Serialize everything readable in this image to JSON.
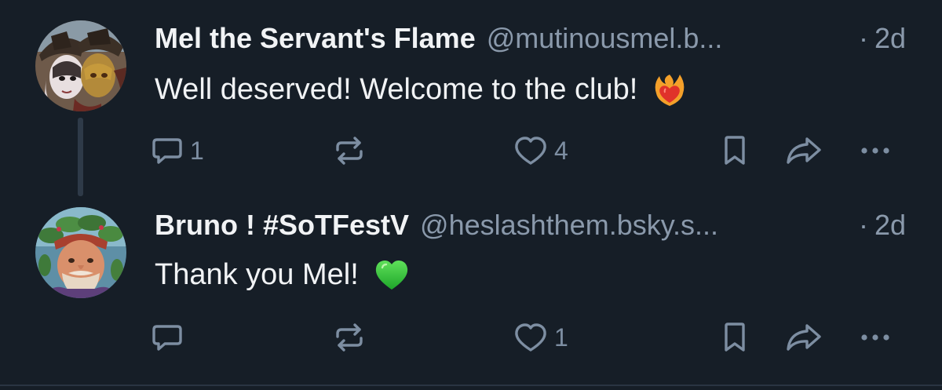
{
  "colors": {
    "background": "#161e27",
    "text_primary": "#f1f3f5",
    "text_secondary": "#8a99ab",
    "icon": "#7d8ea2",
    "thread_line": "#2e3a48"
  },
  "posts": [
    {
      "display_name": "Mel the Servant's Flame",
      "handle": "@mutinousmel.b...",
      "time_separator": "·",
      "time": "2d",
      "text": "Well deserved! Welcome to the club!",
      "emoji": "heart-on-fire-emoji",
      "avatar": "pirate-characters-avatar",
      "actions": {
        "reply_icon": "speech-bubble-icon",
        "reply_count": "1",
        "repost_icon": "repost-arrows-icon",
        "repost_count": "",
        "like_icon": "heart-outline-icon",
        "like_count": "4",
        "bookmark_icon": "bookmark-icon",
        "share_icon": "share-arrow-icon",
        "more_icon": "ellipsis-icon"
      }
    },
    {
      "display_name": "Bruno ! #SoTFestV",
      "handle": "@heslashthem.bsky.s...",
      "time_separator": "·",
      "time": "2d",
      "text": "Thank you Mel!",
      "emoji": "green-heart-emoji",
      "avatar": "pirate-with-wreath-avatar",
      "actions": {
        "reply_icon": "speech-bubble-icon",
        "reply_count": "",
        "repost_icon": "repost-arrows-icon",
        "repost_count": "",
        "like_icon": "heart-outline-icon",
        "like_count": "1",
        "bookmark_icon": "bookmark-icon",
        "share_icon": "share-arrow-icon",
        "more_icon": "ellipsis-icon"
      }
    }
  ]
}
